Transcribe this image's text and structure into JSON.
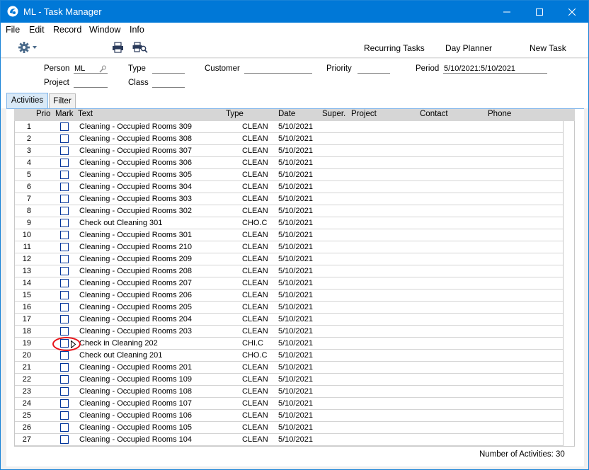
{
  "window": {
    "title": "ML - Task Manager"
  },
  "menu": [
    "File",
    "Edit",
    "Record",
    "Window",
    "Info"
  ],
  "toolbar": {
    "gear_icon": "gear-icon",
    "print_icon": "printer-icon",
    "preview_icon": "print-preview-icon",
    "recurring_tasks": "Recurring Tasks",
    "day_planner": "Day Planner",
    "new_task": "New Task"
  },
  "header": {
    "person_label": "Person",
    "person_value": "ML",
    "type_label": "Type",
    "type_value": "",
    "customer_label": "Customer",
    "customer_value": "",
    "priority_label": "Priority",
    "priority_value": "",
    "period_label": "Period",
    "period_value": "5/10/2021:5/10/2021",
    "project_label": "Project",
    "project_value": "",
    "class_label": "Class",
    "class_value": ""
  },
  "tabs": [
    {
      "label": "Activities",
      "active": true
    },
    {
      "label": "Filter",
      "active": false
    }
  ],
  "columns": {
    "prio": "Prio",
    "mark": "Mark",
    "text": "Text",
    "type": "Type",
    "date": "Date",
    "super": "Super.",
    "project": "Project",
    "contact": "Contact",
    "phone": "Phone"
  },
  "rows": [
    {
      "prio": "1",
      "text": "Cleaning - Occupied Rooms 309",
      "type": "CLEAN",
      "date": "5/10/2021"
    },
    {
      "prio": "2",
      "text": "Cleaning - Occupied Rooms 308",
      "type": "CLEAN",
      "date": "5/10/2021"
    },
    {
      "prio": "3",
      "text": "Cleaning - Occupied Rooms 307",
      "type": "CLEAN",
      "date": "5/10/2021"
    },
    {
      "prio": "4",
      "text": "Cleaning - Occupied Rooms 306",
      "type": "CLEAN",
      "date": "5/10/2021"
    },
    {
      "prio": "5",
      "text": "Cleaning - Occupied Rooms 305",
      "type": "CLEAN",
      "date": "5/10/2021"
    },
    {
      "prio": "6",
      "text": "Cleaning - Occupied Rooms 304",
      "type": "CLEAN",
      "date": "5/10/2021"
    },
    {
      "prio": "7",
      "text": "Cleaning - Occupied Rooms 303",
      "type": "CLEAN",
      "date": "5/10/2021"
    },
    {
      "prio": "8",
      "text": "Cleaning - Occupied Rooms 302",
      "type": "CLEAN",
      "date": "5/10/2021"
    },
    {
      "prio": "9",
      "text": "Check out Cleaning 301",
      "type": "CHO.C",
      "date": "5/10/2021"
    },
    {
      "prio": "10",
      "text": "Cleaning - Occupied Rooms 301",
      "type": "CLEAN",
      "date": "5/10/2021"
    },
    {
      "prio": "11",
      "text": "Cleaning - Occupied Rooms 210",
      "type": "CLEAN",
      "date": "5/10/2021"
    },
    {
      "prio": "12",
      "text": "Cleaning - Occupied Rooms 209",
      "type": "CLEAN",
      "date": "5/10/2021"
    },
    {
      "prio": "13",
      "text": "Cleaning - Occupied Rooms 208",
      "type": "CLEAN",
      "date": "5/10/2021"
    },
    {
      "prio": "14",
      "text": "Cleaning - Occupied Rooms 207",
      "type": "CLEAN",
      "date": "5/10/2021"
    },
    {
      "prio": "15",
      "text": "Cleaning - Occupied Rooms 206",
      "type": "CLEAN",
      "date": "5/10/2021"
    },
    {
      "prio": "16",
      "text": "Cleaning - Occupied Rooms 205",
      "type": "CLEAN",
      "date": "5/10/2021"
    },
    {
      "prio": "17",
      "text": "Cleaning - Occupied Rooms 204",
      "type": "CLEAN",
      "date": "5/10/2021"
    },
    {
      "prio": "18",
      "text": "Cleaning - Occupied Rooms 203",
      "type": "CLEAN",
      "date": "5/10/2021"
    },
    {
      "prio": "19",
      "text": "Check in Cleaning 202",
      "type": "CHI.C",
      "date": "5/10/2021"
    },
    {
      "prio": "20",
      "text": "Check out Cleaning 201",
      "type": "CHO.C",
      "date": "5/10/2021"
    },
    {
      "prio": "21",
      "text": "Cleaning - Occupied Rooms 201",
      "type": "CLEAN",
      "date": "5/10/2021"
    },
    {
      "prio": "22",
      "text": "Cleaning - Occupied Rooms 109",
      "type": "CLEAN",
      "date": "5/10/2021"
    },
    {
      "prio": "23",
      "text": "Cleaning - Occupied Rooms 108",
      "type": "CLEAN",
      "date": "5/10/2021"
    },
    {
      "prio": "24",
      "text": "Cleaning - Occupied Rooms 107",
      "type": "CLEAN",
      "date": "5/10/2021"
    },
    {
      "prio": "25",
      "text": "Cleaning - Occupied Rooms 106",
      "type": "CLEAN",
      "date": "5/10/2021"
    },
    {
      "prio": "26",
      "text": "Cleaning - Occupied Rooms 105",
      "type": "CLEAN",
      "date": "5/10/2021"
    },
    {
      "prio": "27",
      "text": "Cleaning - Occupied Rooms 104",
      "type": "CLEAN",
      "date": "5/10/2021"
    }
  ],
  "footer": {
    "count_text": "Number of Activities: 30"
  },
  "colors": {
    "titlebar": "#0078d7",
    "highlight": "#e8141b",
    "checkbox": "#003399"
  }
}
